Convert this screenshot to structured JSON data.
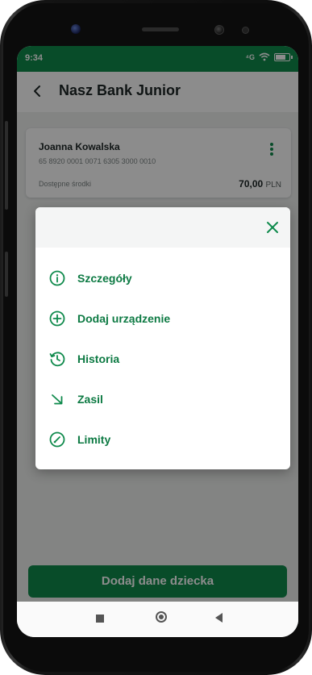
{
  "status_bar": {
    "time": "9:34",
    "signal": "⁴G"
  },
  "header": {
    "title": "Nasz Bank Junior"
  },
  "account": {
    "name": "Joanna Kowalska",
    "number": "65 8920 0001 0071 6305 3000 0010",
    "balance_label": "Dostępne środki",
    "balance_value": "70,00",
    "currency": "PLN"
  },
  "menu": {
    "items": [
      {
        "label": "Szczegóły",
        "icon": "info-icon"
      },
      {
        "label": "Dodaj urządzenie",
        "icon": "plus-circle-icon"
      },
      {
        "label": "Historia",
        "icon": "history-icon"
      },
      {
        "label": "Zasil",
        "icon": "arrow-down-right-icon"
      },
      {
        "label": "Limity",
        "icon": "gauge-icon"
      }
    ]
  },
  "footer": {
    "add_child_label": "Dodaj dane dziecka"
  },
  "colors": {
    "brand": "#0f8a4c",
    "accent_text": "#0d7a43"
  }
}
